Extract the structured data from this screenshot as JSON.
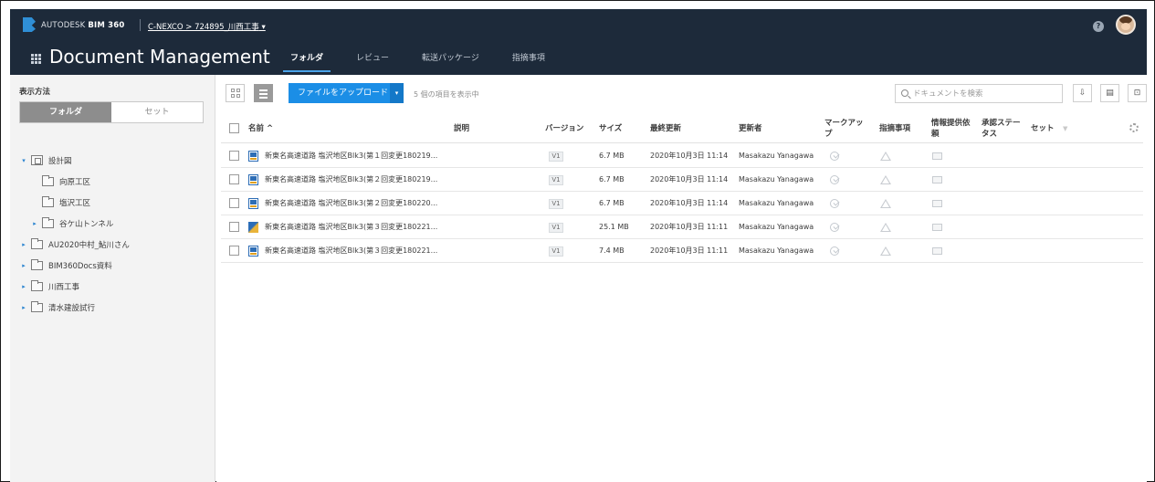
{
  "header": {
    "brand_prefix": "AUTODESK",
    "brand_product": "BIM 360",
    "breadcrumb": "C-NEXCO > 724895_川西工事",
    "breadcrumb_caret": "▾",
    "app_title": "Document Management",
    "tabs": [
      {
        "label": "フォルダ",
        "active": true
      },
      {
        "label": "レビュー",
        "active": false
      },
      {
        "label": "転送パッケージ",
        "active": false
      },
      {
        "label": "指摘事項",
        "active": false
      }
    ],
    "help_label": "?",
    "colors": {
      "bar": "#1d2a3a",
      "accent": "#4aa3ea"
    }
  },
  "sidebar": {
    "view_label": "表示方法",
    "segments": [
      {
        "label": "フォルダ",
        "active": true
      },
      {
        "label": "セット",
        "active": false
      }
    ],
    "tree": [
      {
        "label": "設計図",
        "level": 0,
        "expanded": true,
        "icon": "plan-icon",
        "caret": "▾"
      },
      {
        "label": "向原工区",
        "level": 1,
        "expanded": false,
        "icon": "folder-icon",
        "caret": ""
      },
      {
        "label": "塩沢工区",
        "level": 1,
        "expanded": false,
        "icon": "folder-icon",
        "caret": ""
      },
      {
        "label": "谷ケ山トンネル",
        "level": 1,
        "expanded": false,
        "icon": "folder-icon",
        "caret": "▸"
      },
      {
        "label": "AU2020中村_鮎川さん",
        "level": 0,
        "expanded": false,
        "icon": "folder-icon",
        "caret": "▸"
      },
      {
        "label": "BIM360Docs資料",
        "level": 0,
        "expanded": false,
        "icon": "folder-icon",
        "caret": "▸"
      },
      {
        "label": "川西工事",
        "level": 0,
        "expanded": false,
        "icon": "folder-icon",
        "caret": "▸"
      },
      {
        "label": "清水建設試行",
        "level": 0,
        "expanded": false,
        "icon": "folder-icon",
        "caret": "▸"
      }
    ]
  },
  "toolbar": {
    "upload_label": "ファイルをアップロード",
    "upload_caret": "▾",
    "item_count": "5 個の項目を表示中",
    "search_placeholder": "ドキュメントを検索"
  },
  "table": {
    "columns": {
      "name": "名前 ^",
      "description": "説明",
      "version": "バージョン",
      "size": "サイズ",
      "updated": "最終更新",
      "updated_by": "更新者",
      "markup_1": "マークアッ",
      "markup_2": "プ",
      "issues": "指摘事項",
      "rfi_1": "情報提供依",
      "rfi_2": "頼",
      "approval_1": "承認ステー",
      "approval_2": "タス",
      "set": "セット",
      "set_filter": "▼"
    },
    "rows": [
      {
        "name": "新東名高速道路 塩沢地区Blk3(第１回変更180219...",
        "icon": "pdf-doc-icon",
        "version": "V1",
        "size": "6.7 MB",
        "updated": "2020年10月3日 11:14",
        "updated_by": "Masakazu Yanagawa"
      },
      {
        "name": "新東名高速道路 塩沢地区Blk3(第２回変更180219...",
        "icon": "pdf-doc-icon",
        "version": "V1",
        "size": "6.7 MB",
        "updated": "2020年10月3日 11:14",
        "updated_by": "Masakazu Yanagawa"
      },
      {
        "name": "新東名高速道路 塩沢地区Blk3(第２回変更180220...",
        "icon": "pdf-doc-icon",
        "version": "V1",
        "size": "6.7 MB",
        "updated": "2020年10月3日 11:14",
        "updated_by": "Masakazu Yanagawa"
      },
      {
        "name": "新東名高速道路 塩沢地区Blk3(第３回変更180221...",
        "icon": "image-doc-icon",
        "version": "V1",
        "size": "25.1 MB",
        "updated": "2020年10月3日 11:11",
        "updated_by": "Masakazu Yanagawa"
      },
      {
        "name": "新東名高速道路 塩沢地区Blk3(第３回変更180221...",
        "icon": "pdf-doc-icon",
        "version": "V1",
        "size": "7.4 MB",
        "updated": "2020年10月3日 11:11",
        "updated_by": "Masakazu Yanagawa"
      }
    ]
  }
}
